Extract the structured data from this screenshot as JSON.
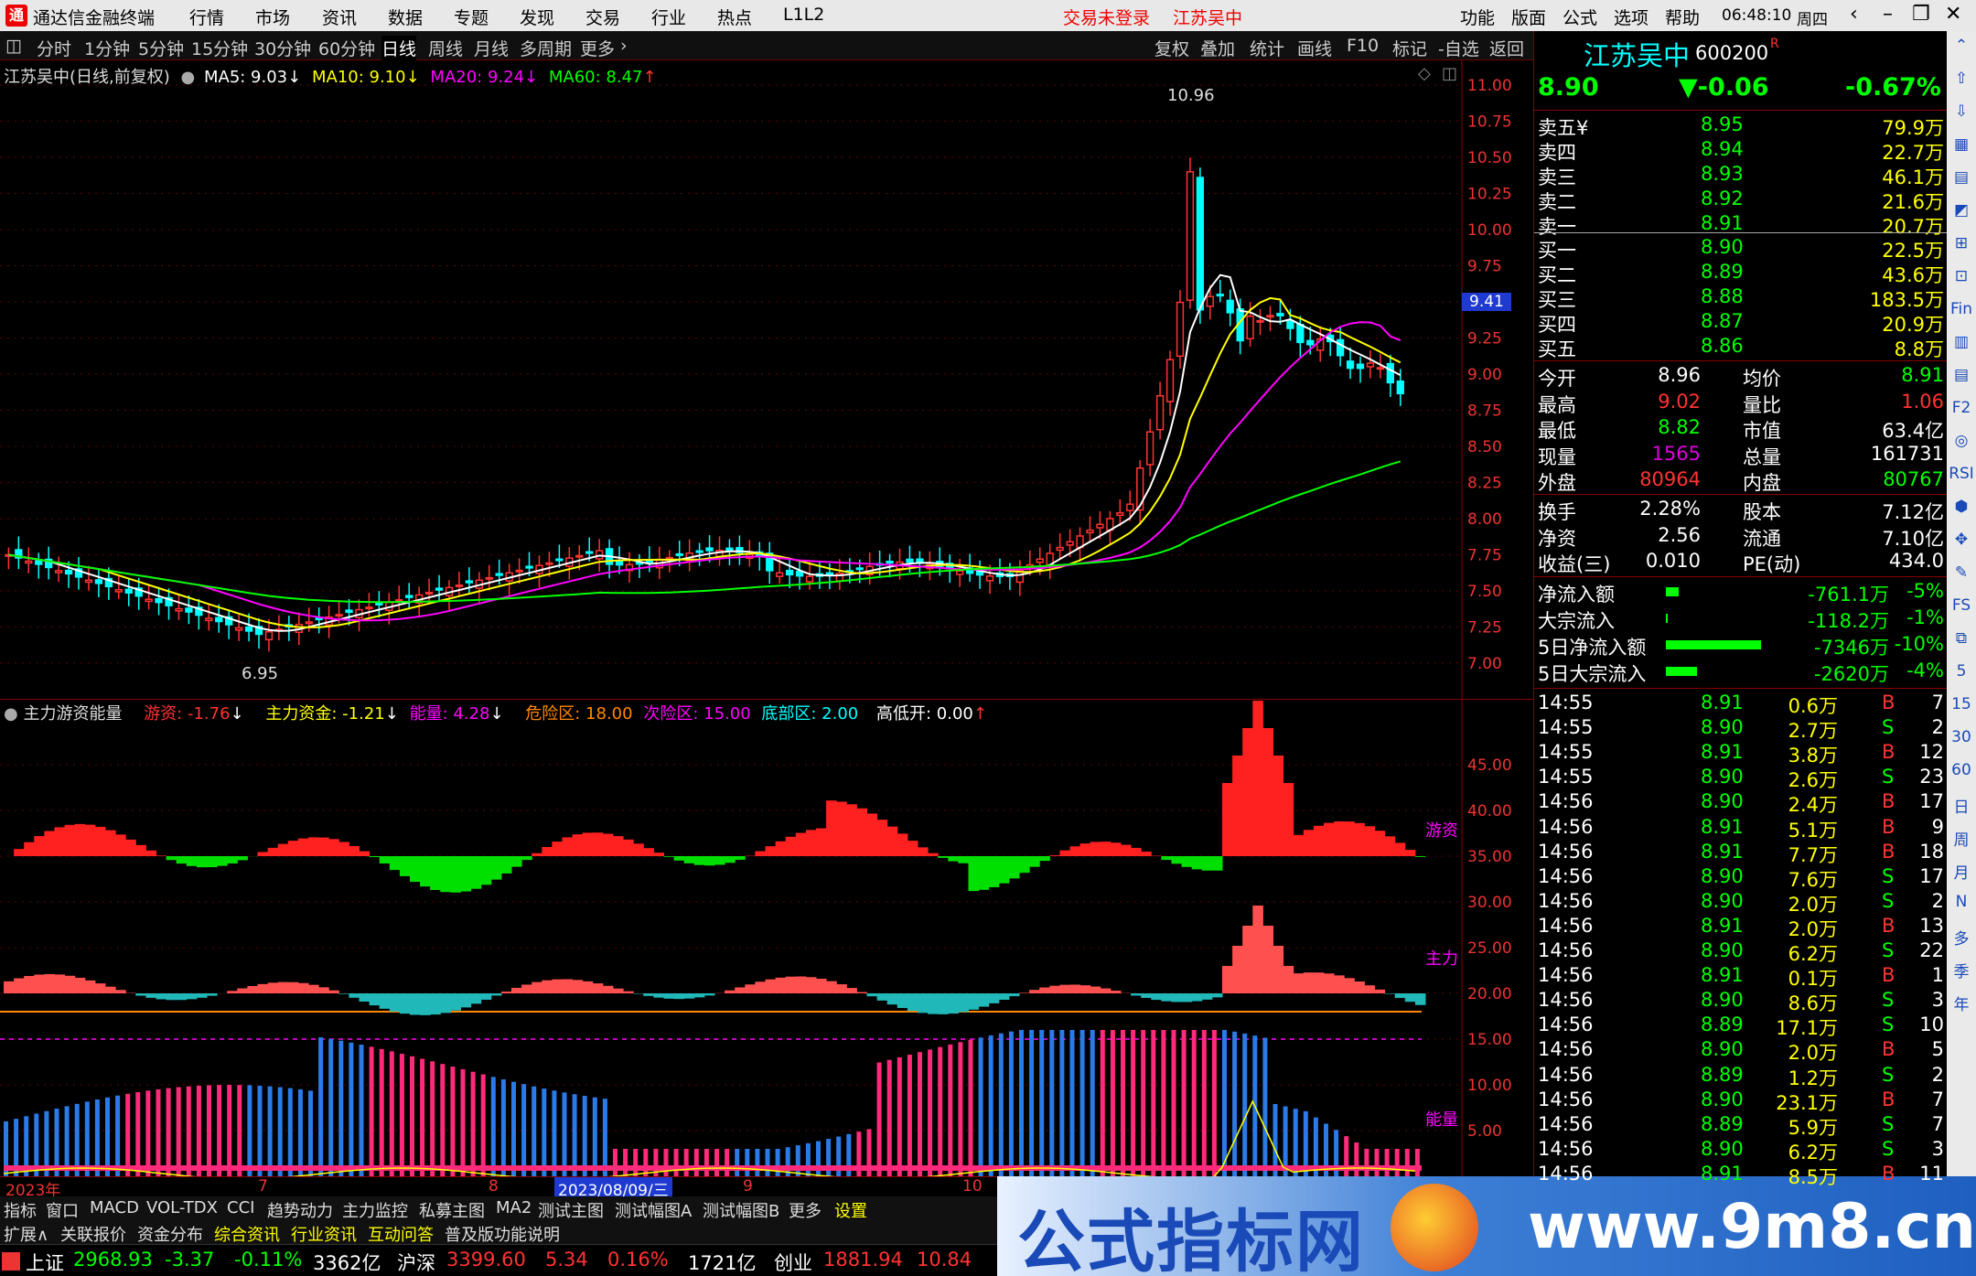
{
  "titlebar": {
    "app": "通达信金融终端",
    "menus": [
      "行情",
      "市场",
      "资讯",
      "数据",
      "专题",
      "发现",
      "交易",
      "行业",
      "热点",
      "L1L2"
    ],
    "warn1": "交易未登录",
    "warn2": "江苏吴中",
    "rmenus": [
      "功能",
      "版面",
      "公式",
      "选项",
      "帮助"
    ],
    "time": "06:48:10",
    "weekday": "周四"
  },
  "period_bar": {
    "items": [
      "分时",
      "1分钟",
      "5分钟",
      "15分钟",
      "30分钟",
      "60分钟",
      "日线",
      "周线",
      "月线",
      "多周期",
      "更多"
    ],
    "right": [
      "复权",
      "叠加",
      "统计",
      "画线",
      "F10",
      "标记",
      "-自选",
      "返回"
    ]
  },
  "main_legend": {
    "title": "江苏吴中(日线,前复权)",
    "ma5": "MA5: 9.03",
    "ma10": "MA10: 9.10",
    "ma20": "MA20: 9.24",
    "ma60": "MA60: 8.47",
    "high_label": "10.96",
    "low_label": "6.95",
    "cursor_price": "9.41",
    "ytick_labels": [
      "11.00",
      "10.75",
      "10.50",
      "10.25",
      "10.00",
      "9.75",
      "9.50",
      "9.25",
      "9.00",
      "8.75",
      "8.50",
      "8.25",
      "8.00",
      "7.75",
      "7.50",
      "7.25",
      "7.00"
    ],
    "yticks": [
      11.0,
      10.75,
      10.5,
      10.25,
      10.0,
      9.75,
      9.5,
      9.25,
      9.0,
      8.75,
      8.5,
      8.25,
      8.0,
      7.75,
      7.5,
      7.25,
      7.0
    ]
  },
  "indicator_legend": {
    "name": "主力游资能量",
    "youzi": "游资: -1.76",
    "zhuli": "主力资金: -1.21",
    "nengliang": "能量: 4.28",
    "danger": "危险区: 18.00",
    "sub_danger": "次险区: 15.00",
    "bottom": "底部区: 2.00",
    "gaodikai": "高低开: 0.00",
    "tag_youzi": "游资",
    "tag_zhuli": "主力",
    "tag_nengliang": "能量",
    "ytick_labels": [
      "45.00",
      "40.00",
      "35.00",
      "30.00",
      "25.00",
      "20.00",
      "15.00",
      "10.00",
      "5.00"
    ],
    "yticks": [
      45,
      40,
      35,
      30,
      25,
      20,
      15,
      10,
      5
    ]
  },
  "datebar": {
    "labels": [
      "2023年",
      "7",
      "8",
      "2023/08/09/三",
      "9",
      "10"
    ]
  },
  "tabbar1": [
    "指标",
    "窗口",
    "MACD",
    "VOL-TDX",
    "CCI",
    "趋势动力",
    "主力监控",
    "私募主图",
    "MA2",
    "测试主图",
    "测试幅图A",
    "测试幅图B",
    "更多",
    "设置"
  ],
  "tabbar2": [
    "扩展∧",
    "关联报价",
    "资金分布",
    "综合资讯",
    "行业资讯",
    "互动问答",
    "普及版功能说明"
  ],
  "statusbar": {
    "sh_name": "上证",
    "sh_val": "2968.93",
    "sh_chg": "-3.37",
    "sh_pct": "-0.11%",
    "sh_amt": "3362亿",
    "hs_name": "沪深",
    "hs_val": "3399.60",
    "hs_chg": "5.34",
    "hs_pct": "0.16%",
    "hs_amt": "1721亿",
    "cy_name": "创业",
    "cy_val": "1881.94",
    "cy_chg": "10.84"
  },
  "banner": {
    "cn": "公式指标网",
    "url": "www.9m8.cn"
  },
  "quote": {
    "name": "江苏吴中",
    "code": "600200",
    "r_mark": "R",
    "price": "8.90",
    "change": "▼-0.06",
    "pct": "-0.67%",
    "asks": [
      {
        "label": "卖五",
        "extra": "¥",
        "price": "8.95",
        "vol": "79.9万"
      },
      {
        "label": "卖四",
        "extra": "",
        "price": "8.94",
        "vol": "22.7万"
      },
      {
        "label": "卖三",
        "extra": "",
        "price": "8.93",
        "vol": "46.1万"
      },
      {
        "label": "卖二",
        "extra": "",
        "price": "8.92",
        "vol": "21.6万"
      },
      {
        "label": "卖一",
        "extra": "",
        "price": "8.91",
        "vol": "20.7万"
      }
    ],
    "bids": [
      {
        "label": "买一",
        "price": "8.90",
        "vol": "22.5万"
      },
      {
        "label": "买二",
        "price": "8.89",
        "vol": "43.6万"
      },
      {
        "label": "买三",
        "price": "8.88",
        "vol": "183.5万"
      },
      {
        "label": "买四",
        "price": "8.87",
        "vol": "20.9万"
      },
      {
        "label": "买五",
        "price": "8.86",
        "vol": "8.8万"
      }
    ],
    "stats": [
      {
        "l1": "今开",
        "v1": "8.96",
        "c1": "#fff",
        "l2": "均价",
        "v2": "8.91",
        "c2": "#0f0"
      },
      {
        "l1": "最高",
        "v1": "9.02",
        "c1": "#f33",
        "l2": "量比",
        "v2": "1.06",
        "c2": "#f33"
      },
      {
        "l1": "最低",
        "v1": "8.82",
        "c1": "#0f0",
        "l2": "市值",
        "v2": "63.4亿",
        "c2": "#fff"
      },
      {
        "l1": "现量",
        "v1": "1565",
        "c1": "#d0d",
        "l2": "总量",
        "v2": "161731",
        "c2": "#fff"
      },
      {
        "l1": "外盘",
        "v1": "80964",
        "c1": "#f33",
        "l2": "内盘",
        "v2": "80767",
        "c2": "#0f0"
      }
    ],
    "stats2": [
      {
        "l1": "换手",
        "v1": "2.28%",
        "l2": "股本",
        "v2": "7.12亿"
      },
      {
        "l1": "净资",
        "v1": "2.56",
        "l2": "流通",
        "v2": "7.10亿"
      },
      {
        "l1": "收益(三)",
        "v1": "0.010",
        "l2": "PE(动)",
        "v2": "434.0"
      }
    ],
    "flows": [
      {
        "label": "净流入额",
        "val": "-761.1万",
        "pct": "-5%",
        "bar": 0.13
      },
      {
        "label": "大宗流入",
        "val": "-118.2万",
        "pct": "-1%",
        "bar": 0.02
      },
      {
        "label": "5日净流入额",
        "val": "-7346万",
        "pct": "-10%",
        "bar": 1.0
      },
      {
        "label": "5日大宗流入",
        "val": "-2620万",
        "pct": "-4%",
        "bar": 0.33
      }
    ],
    "ticks": [
      {
        "t": "14:55",
        "p": "8.91",
        "v": "0.6万",
        "s": "B",
        "n": "7"
      },
      {
        "t": "14:55",
        "p": "8.90",
        "v": "2.7万",
        "s": "S",
        "n": "2"
      },
      {
        "t": "14:55",
        "p": "8.91",
        "v": "3.8万",
        "s": "B",
        "n": "12"
      },
      {
        "t": "14:55",
        "p": "8.90",
        "v": "2.6万",
        "s": "S",
        "n": "23"
      },
      {
        "t": "14:56",
        "p": "8.90",
        "v": "2.4万",
        "s": "B",
        "n": "17"
      },
      {
        "t": "14:56",
        "p": "8.91",
        "v": "5.1万",
        "s": "B",
        "n": "9"
      },
      {
        "t": "14:56",
        "p": "8.91",
        "v": "7.7万",
        "s": "B",
        "n": "18"
      },
      {
        "t": "14:56",
        "p": "8.90",
        "v": "7.6万",
        "s": "S",
        "n": "17"
      },
      {
        "t": "14:56",
        "p": "8.90",
        "v": "2.0万",
        "s": "S",
        "n": "2"
      },
      {
        "t": "14:56",
        "p": "8.91",
        "v": "2.0万",
        "s": "B",
        "n": "13"
      },
      {
        "t": "14:56",
        "p": "8.90",
        "v": "6.2万",
        "s": "S",
        "n": "22"
      },
      {
        "t": "14:56",
        "p": "8.91",
        "v": "0.1万",
        "s": "B",
        "n": "1"
      },
      {
        "t": "14:56",
        "p": "8.90",
        "v": "8.6万",
        "s": "S",
        "n": "3"
      },
      {
        "t": "14:56",
        "p": "8.89",
        "v": "17.1万",
        "s": "S",
        "n": "10"
      },
      {
        "t": "14:56",
        "p": "8.90",
        "v": "2.0万",
        "s": "B",
        "n": "5"
      },
      {
        "t": "14:56",
        "p": "8.89",
        "v": "1.2万",
        "s": "S",
        "n": "2"
      },
      {
        "t": "14:56",
        "p": "8.90",
        "v": "23.1万",
        "s": "B",
        "n": "7"
      },
      {
        "t": "14:56",
        "p": "8.89",
        "v": "5.9万",
        "s": "S",
        "n": "7"
      },
      {
        "t": "14:56",
        "p": "8.90",
        "v": "6.2万",
        "s": "S",
        "n": "3"
      },
      {
        "t": "14:56",
        "p": "8.91",
        "v": "8.5万",
        "s": "B",
        "n": "11"
      }
    ]
  },
  "iconcol": [
    "⌃",
    "⇧",
    "⇩",
    "▦",
    "▤",
    "◩",
    "⊞",
    "⊡",
    "Fin",
    "▥",
    "▤",
    "F2",
    "◎",
    "RSI",
    "⬢",
    "✥",
    "✎",
    "FS",
    "⧉",
    "5",
    "15",
    "30",
    "60",
    "日",
    "周",
    "月",
    "N",
    "多",
    "季",
    "年"
  ],
  "colors": {
    "up": "#ff3333",
    "down": "#00ffff",
    "ma5": "#ffffff",
    "ma10": "#ffff00",
    "ma20": "#ff00ff",
    "ma60": "#00ff00"
  }
}
